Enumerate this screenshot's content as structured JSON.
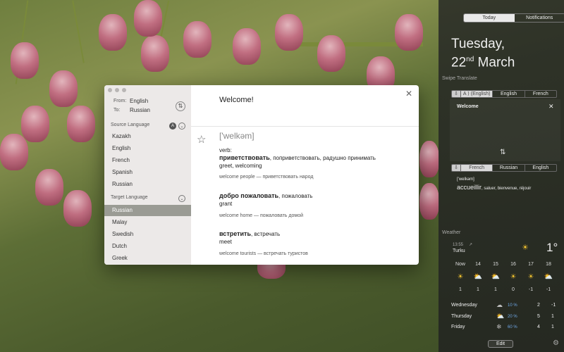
{
  "popup": {
    "from_label": "From:",
    "from_value": "English",
    "to_label": "To:",
    "to_value": "Russian",
    "source_heading": "Source Language",
    "source_badge": "A",
    "source_langs": [
      "Kazakh",
      "English",
      "French",
      "Spanish",
      "Russian"
    ],
    "target_heading": "Target Language",
    "target_langs": [
      "Russian",
      "Malay",
      "Swedish",
      "Dutch",
      "Greek"
    ],
    "selected_target": "Russian",
    "query": "Welcome!",
    "ipa": "['welkəm]",
    "pos": "verb:",
    "entries": [
      {
        "main": "приветствовать",
        "alts": ", поприветствовать, радушно принимать",
        "gloss": "greet, welcoming",
        "ex_en": "welcome people",
        "ex_ru": "приветствовать народ"
      },
      {
        "main": "добро пожаловать",
        "alts": ", пожаловать",
        "gloss": "grant",
        "ex_en": "welcome home",
        "ex_ru": "пожаловать домой"
      },
      {
        "main": "встретить",
        "alts": ", встречать",
        "gloss": "meet",
        "ex_en": "welcome tourists",
        "ex_ru": "встречать туристов"
      }
    ],
    "ex_sep": "—"
  },
  "nc": {
    "tab_today": "Today",
    "tab_notifications": "Notifications",
    "weekday": "Tuesday,",
    "day": "22",
    "day_suffix": "nd",
    "month": "March",
    "swipe_title": "Swipe Translate",
    "bar1": [
      "A ⟩ (English)",
      "English",
      "French"
    ],
    "input_text": "Welcome",
    "bar2": [
      "French",
      "Russian",
      "English"
    ],
    "out_ipa": "['welkəm]",
    "out_main": "accueillir",
    "out_alts": ", saluer, bienvenue, réjouir",
    "weather_title": "Weather",
    "time": "13:55",
    "city": "Turku",
    "temp": "1°",
    "forecast_days": [
      "Now",
      "14",
      "15",
      "16",
      "17",
      "18"
    ],
    "forecast_icons": [
      "sun",
      "partly",
      "partly",
      "sun",
      "sun",
      "partly"
    ],
    "forecast_temps": [
      "1",
      "1",
      "1",
      "0",
      "-1",
      "-1"
    ],
    "daily": [
      {
        "day": "Wednesday",
        "icon": "cloud",
        "precip": "10 %",
        "hi": "2",
        "lo": "-1"
      },
      {
        "day": "Thursday",
        "icon": "partly",
        "precip": "20 %",
        "hi": "5",
        "lo": "1"
      },
      {
        "day": "Friday",
        "icon": "snow",
        "precip": "60 %",
        "hi": "4",
        "lo": "1"
      }
    ],
    "edit_label": "Edit"
  },
  "colors": {
    "accent_blue": "#4a90d9",
    "selected_row": "#9a9b94",
    "sun": "#f4c430"
  }
}
